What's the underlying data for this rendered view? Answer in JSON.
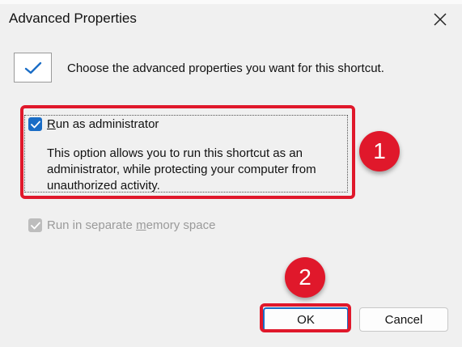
{
  "window": {
    "title": "Advanced Properties"
  },
  "header": {
    "text": "Choose the advanced properties you want for this shortcut."
  },
  "options": {
    "run_as_admin": {
      "label_prefix": "",
      "label_access": "R",
      "label_rest": "un as administrator",
      "checked": true,
      "description": "This option allows you to run this shortcut as an administrator, while protecting your computer from unauthorized activity."
    },
    "separate_memory": {
      "label_prefix": "Run in separate ",
      "label_access": "m",
      "label_rest": "emory space",
      "checked": true,
      "enabled": false
    }
  },
  "buttons": {
    "ok": "OK",
    "cancel": "Cancel"
  },
  "annotations": {
    "step1": "1",
    "step2": "2"
  },
  "colors": {
    "accent": "#1a6dc6",
    "highlight": "#e0182b"
  }
}
